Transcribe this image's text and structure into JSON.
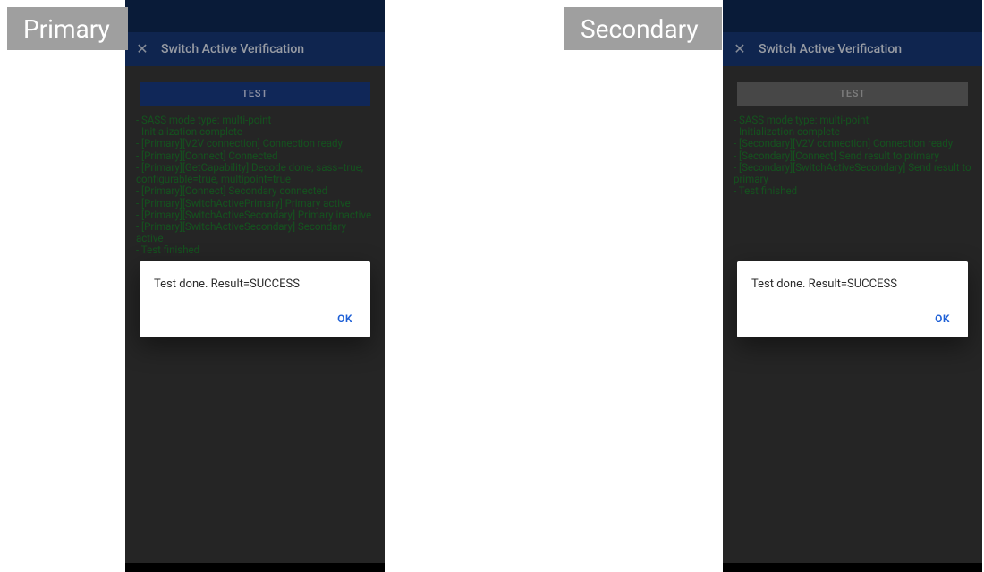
{
  "labels": {
    "primary": "Primary",
    "secondary": "Secondary"
  },
  "appbar": {
    "title": "Switch Active Verification"
  },
  "test_button_label": "TEST",
  "primary_log": [
    "- SASS mode type: multi-point",
    "- Initialization complete",
    "- [Primary][V2V connection] Connection ready",
    "- [Primary][Connect] Connected",
    "- [Primary][GetCapability] Decode done, sass=true, configurable=true, multipoint=true",
    "- [Primary][Connect] Secondary connected",
    "- [Primary][SwitchActivePrimary] Primary active",
    "- [Primary][SwitchActiveSecondary] Primary inactive",
    "- [Primary][SwitchActiveSecondary] Secondary active",
    "- Test finished"
  ],
  "secondary_log": [
    "- SASS mode type: multi-point",
    "- Initialization complete",
    "- [Secondary][V2V connection] Connection ready",
    "- [Secondary][Connect] Send result to primary",
    "- [Secondary][SwitchActiveSecondary] Send result to primary",
    "- Test finished"
  ],
  "dialog": {
    "message": "Test done. Result=SUCCESS",
    "ok": "OK"
  },
  "dialog_top": {
    "primary": 292,
    "secondary": 292
  },
  "colors": {
    "log_text": "#1f7f2f",
    "appbar_bg": "#173a7a",
    "status_bg": "#0f2a56",
    "button_bg": "#1a3c88",
    "ok_text": "#1d5fd6"
  }
}
